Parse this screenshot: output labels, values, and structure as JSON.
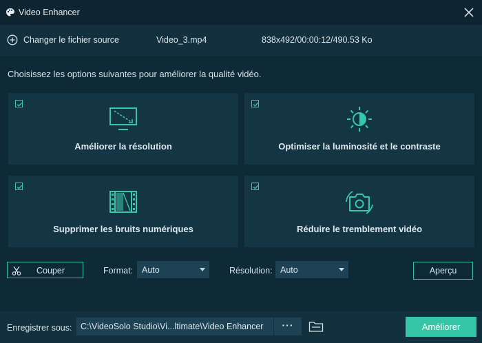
{
  "window": {
    "title": "Video Enhancer"
  },
  "source": {
    "change_label": "Changer le fichier source",
    "filename": "Video_3.mp4",
    "info": "838x492/00:00:12/490.53 Ko"
  },
  "instruction": "Choisissez les options suivantes pour améliorer la qualité vidéo.",
  "options": [
    {
      "label": "Améliorer la résolution",
      "checked": true,
      "icon": "upscale-monitor-icon"
    },
    {
      "label": "Optimiser la luminosité et le contraste",
      "checked": true,
      "icon": "brightness-icon"
    },
    {
      "label": "Supprimer les bruits numériques",
      "checked": true,
      "icon": "film-noise-icon"
    },
    {
      "label": "Réduire le tremblement vidéo",
      "checked": true,
      "icon": "stabilize-camera-icon"
    }
  ],
  "toolbar": {
    "cut_label": "Couper",
    "format_label": "Format:",
    "format_value": "Auto",
    "resolution_label": "Résolution:",
    "resolution_value": "Auto",
    "preview_label": "Aperçu"
  },
  "output": {
    "save_label": "Enregistrer sous:",
    "path": "C:\\VideoSolo Studio\\Vi...ltimate\\Video Enhancer",
    "browse_label": "···",
    "enhance_label": "Améliorer"
  },
  "colors": {
    "accent": "#35c6a7",
    "background": "#0f2a37",
    "card": "#143544"
  }
}
